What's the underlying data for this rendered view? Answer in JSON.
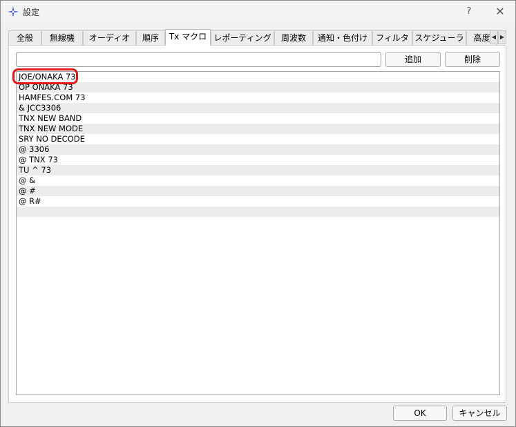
{
  "window": {
    "title": "設定"
  },
  "titlebar": {
    "help_label": "?",
    "close_label": "✕"
  },
  "tabs": [
    {
      "label": "全般"
    },
    {
      "label": "無線機"
    },
    {
      "label": "オーディオ"
    },
    {
      "label": "順序"
    },
    {
      "label": "Tx マクロ",
      "active": true
    },
    {
      "label": "レポーティング"
    },
    {
      "label": "周波数"
    },
    {
      "label": "通知・色付け"
    },
    {
      "label": "フィルタ"
    },
    {
      "label": "スケジューラ"
    },
    {
      "label": "高度"
    }
  ],
  "tab_scroll": {
    "left": "◀",
    "right": "▶"
  },
  "macro_editor": {
    "input_value": "",
    "add_label": "追加",
    "delete_label": "削除"
  },
  "macros": [
    "JOE/ONAKA 73",
    "OP ONAKA 73",
    "HAMFES.COM 73",
    "& JCC3306",
    "TNX NEW BAND",
    "TNX NEW MODE",
    "SRY NO DECODE",
    "@ 3306",
    "@ TNX 73",
    "TU ^ 73",
    "@ &",
    "@ #",
    "@ R#",
    ""
  ],
  "footer": {
    "ok_label": "OK",
    "cancel_label": "キャンセル"
  },
  "colors": {
    "highlight": "#e01818",
    "app_icon": "#3b4fd8"
  },
  "icons": {
    "app": "app-sparkle-icon",
    "close": "close-icon",
    "help": "help-icon"
  }
}
